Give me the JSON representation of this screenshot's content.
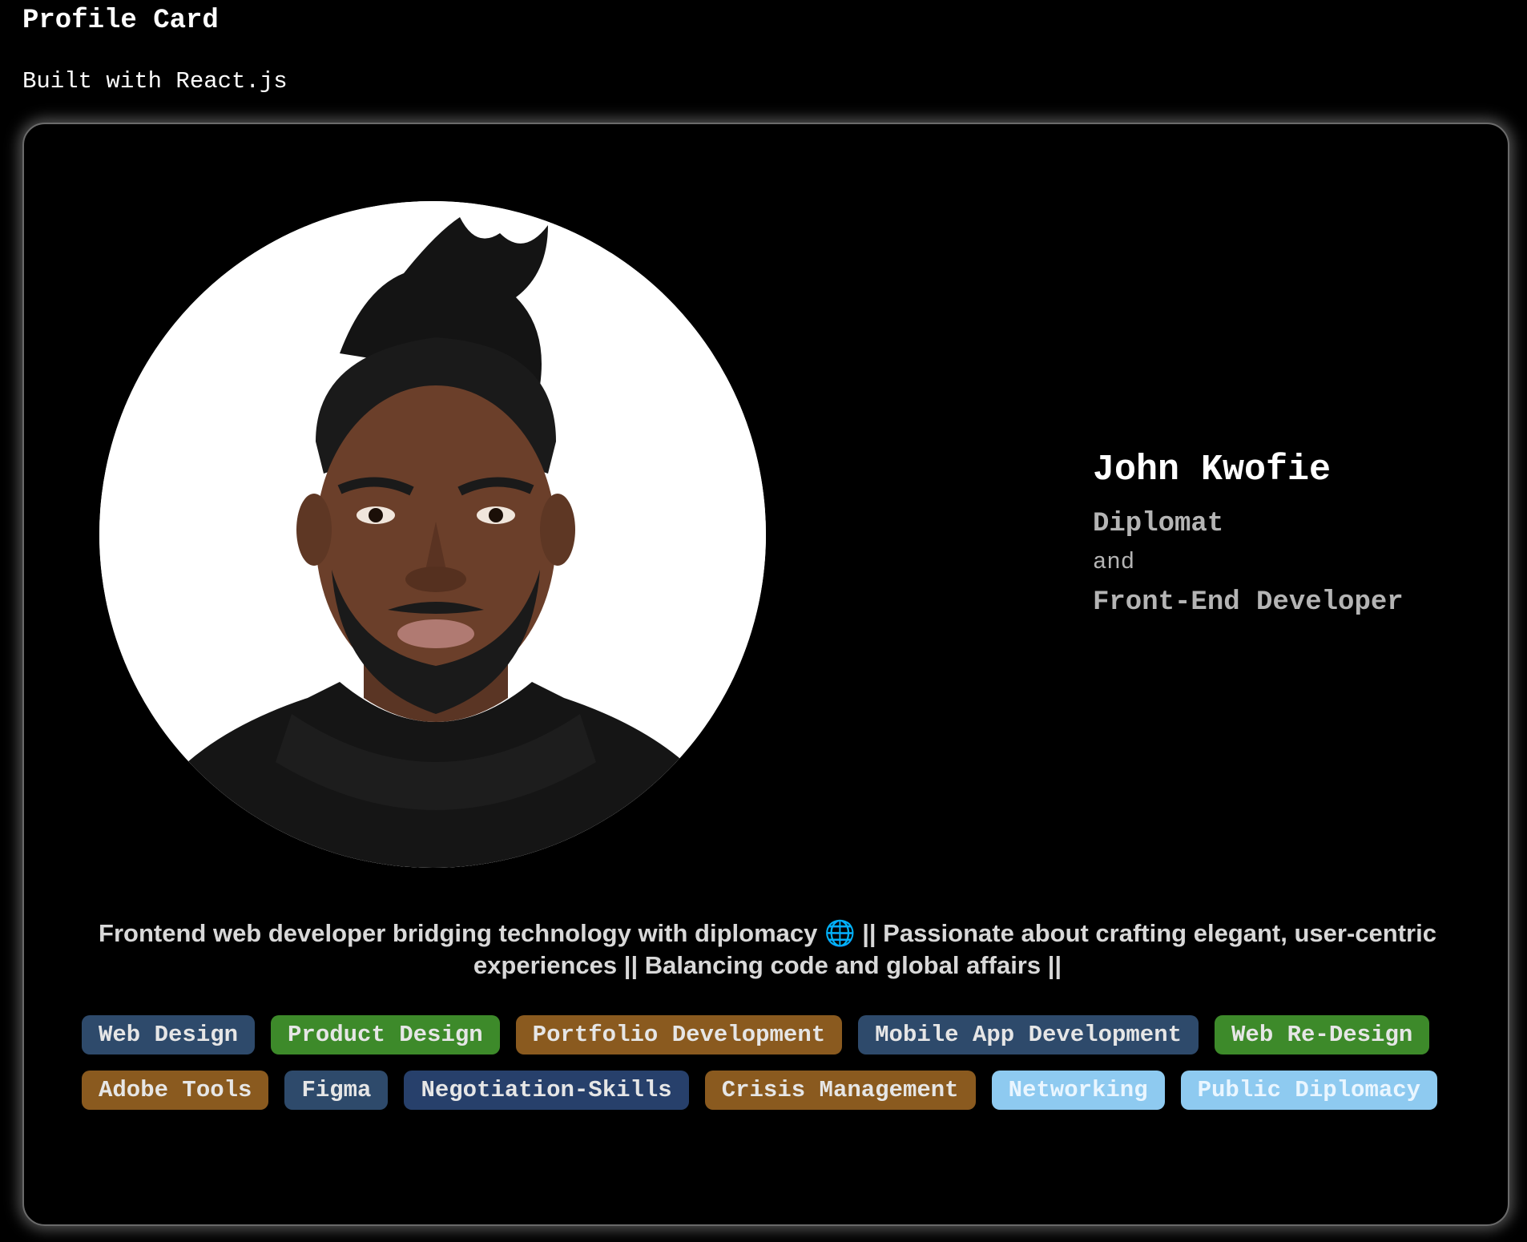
{
  "page": {
    "title": "Profile Card",
    "subtitle": "Built with React.js"
  },
  "profile": {
    "name": "John Kwofie",
    "role_primary": "Diplomat",
    "role_conjunction": "and",
    "role_secondary": "Front-End Developer",
    "avatar_icon": "profile-photo",
    "bio": "Frontend web developer bridging technology with diplomacy 🌐 || Passionate about crafting elegant, user-centric experiences || Balancing code and global affairs ||"
  },
  "colors": {
    "background": "#000000",
    "card_border": "#6a6a6a",
    "slate_blue": "#2e4a6b",
    "green": "#3d8a2a",
    "brown": "#8a5a1f",
    "navy": "#27406b",
    "light_blue": "#8ecaf0"
  },
  "skills": [
    {
      "label": "Web Design",
      "color": "#2e4a6b",
      "text_color": "#e6e6e6"
    },
    {
      "label": "Product Design",
      "color": "#3d8a2a",
      "text_color": "#e6e6e6"
    },
    {
      "label": "Portfolio Development",
      "color": "#8a5a1f",
      "text_color": "#e6e6e6"
    },
    {
      "label": "Mobile App Development",
      "color": "#2e4a6b",
      "text_color": "#e6e6e6"
    },
    {
      "label": "Web Re-Design",
      "color": "#3d8a2a",
      "text_color": "#e6e6e6"
    },
    {
      "label": "Adobe Tools",
      "color": "#8a5a1f",
      "text_color": "#e6e6e6"
    },
    {
      "label": "Figma",
      "color": "#2e4a6b",
      "text_color": "#e6e6e6"
    },
    {
      "label": "Negotiation-Skills",
      "color": "#27406b",
      "text_color": "#e6e6e6"
    },
    {
      "label": "Crisis Management",
      "color": "#8a5a1f",
      "text_color": "#e6e6e6"
    },
    {
      "label": "Networking",
      "color": "#8ecaf0",
      "text_color": "#eaf6ff"
    },
    {
      "label": "Public Diplomacy",
      "color": "#8ecaf0",
      "text_color": "#eaf6ff"
    }
  ]
}
